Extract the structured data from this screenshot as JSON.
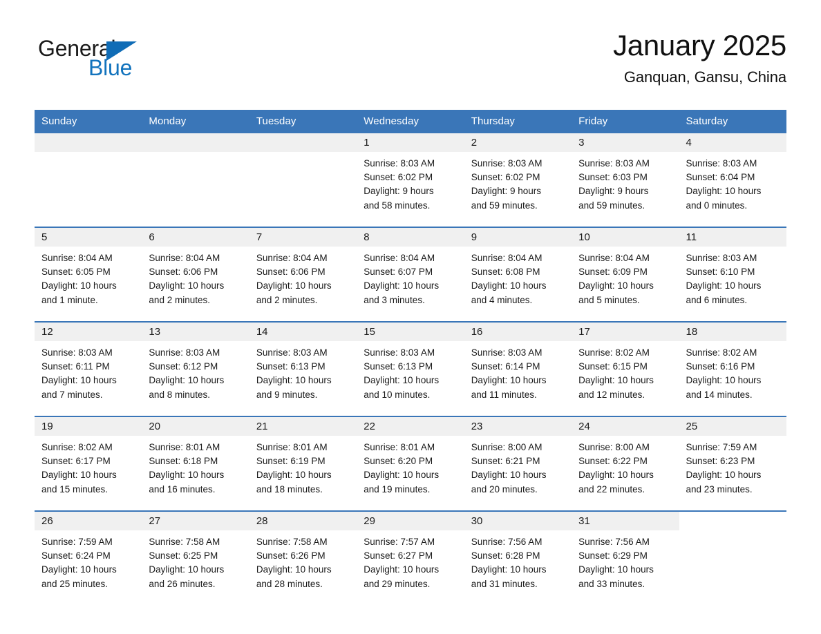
{
  "brand": {
    "name_part1": "General",
    "name_part2": "Blue",
    "triangle_color": "#0f6cb6",
    "blue_color": "#1273bd"
  },
  "header": {
    "month_title": "January 2025",
    "location": "Ganquan, Gansu, China"
  },
  "theme": {
    "header_bg": "#3a76b8",
    "header_text": "#ffffff",
    "daynum_band_bg": "#f0f0f0",
    "row_divider": "#3a76b8",
    "cell_bg": "#ffffff",
    "text": "#1a1a1a"
  },
  "weekday_headers": [
    "Sunday",
    "Monday",
    "Tuesday",
    "Wednesday",
    "Thursday",
    "Friday",
    "Saturday"
  ],
  "weeks": [
    [
      {
        "day": "",
        "sunrise": "",
        "sunset": "",
        "daylight_line1": "",
        "daylight_line2": "",
        "empty": true
      },
      {
        "day": "",
        "sunrise": "",
        "sunset": "",
        "daylight_line1": "",
        "daylight_line2": "",
        "empty": true
      },
      {
        "day": "",
        "sunrise": "",
        "sunset": "",
        "daylight_line1": "",
        "daylight_line2": "",
        "empty": true
      },
      {
        "day": "1",
        "sunrise": "Sunrise: 8:03 AM",
        "sunset": "Sunset: 6:02 PM",
        "daylight_line1": "Daylight: 9 hours",
        "daylight_line2": "and 58 minutes."
      },
      {
        "day": "2",
        "sunrise": "Sunrise: 8:03 AM",
        "sunset": "Sunset: 6:02 PM",
        "daylight_line1": "Daylight: 9 hours",
        "daylight_line2": "and 59 minutes."
      },
      {
        "day": "3",
        "sunrise": "Sunrise: 8:03 AM",
        "sunset": "Sunset: 6:03 PM",
        "daylight_line1": "Daylight: 9 hours",
        "daylight_line2": "and 59 minutes."
      },
      {
        "day": "4",
        "sunrise": "Sunrise: 8:03 AM",
        "sunset": "Sunset: 6:04 PM",
        "daylight_line1": "Daylight: 10 hours",
        "daylight_line2": "and 0 minutes."
      }
    ],
    [
      {
        "day": "5",
        "sunrise": "Sunrise: 8:04 AM",
        "sunset": "Sunset: 6:05 PM",
        "daylight_line1": "Daylight: 10 hours",
        "daylight_line2": "and 1 minute."
      },
      {
        "day": "6",
        "sunrise": "Sunrise: 8:04 AM",
        "sunset": "Sunset: 6:06 PM",
        "daylight_line1": "Daylight: 10 hours",
        "daylight_line2": "and 2 minutes."
      },
      {
        "day": "7",
        "sunrise": "Sunrise: 8:04 AM",
        "sunset": "Sunset: 6:06 PM",
        "daylight_line1": "Daylight: 10 hours",
        "daylight_line2": "and 2 minutes."
      },
      {
        "day": "8",
        "sunrise": "Sunrise: 8:04 AM",
        "sunset": "Sunset: 6:07 PM",
        "daylight_line1": "Daylight: 10 hours",
        "daylight_line2": "and 3 minutes."
      },
      {
        "day": "9",
        "sunrise": "Sunrise: 8:04 AM",
        "sunset": "Sunset: 6:08 PM",
        "daylight_line1": "Daylight: 10 hours",
        "daylight_line2": "and 4 minutes."
      },
      {
        "day": "10",
        "sunrise": "Sunrise: 8:04 AM",
        "sunset": "Sunset: 6:09 PM",
        "daylight_line1": "Daylight: 10 hours",
        "daylight_line2": "and 5 minutes."
      },
      {
        "day": "11",
        "sunrise": "Sunrise: 8:03 AM",
        "sunset": "Sunset: 6:10 PM",
        "daylight_line1": "Daylight: 10 hours",
        "daylight_line2": "and 6 minutes."
      }
    ],
    [
      {
        "day": "12",
        "sunrise": "Sunrise: 8:03 AM",
        "sunset": "Sunset: 6:11 PM",
        "daylight_line1": "Daylight: 10 hours",
        "daylight_line2": "and 7 minutes."
      },
      {
        "day": "13",
        "sunrise": "Sunrise: 8:03 AM",
        "sunset": "Sunset: 6:12 PM",
        "daylight_line1": "Daylight: 10 hours",
        "daylight_line2": "and 8 minutes."
      },
      {
        "day": "14",
        "sunrise": "Sunrise: 8:03 AM",
        "sunset": "Sunset: 6:13 PM",
        "daylight_line1": "Daylight: 10 hours",
        "daylight_line2": "and 9 minutes."
      },
      {
        "day": "15",
        "sunrise": "Sunrise: 8:03 AM",
        "sunset": "Sunset: 6:13 PM",
        "daylight_line1": "Daylight: 10 hours",
        "daylight_line2": "and 10 minutes."
      },
      {
        "day": "16",
        "sunrise": "Sunrise: 8:03 AM",
        "sunset": "Sunset: 6:14 PM",
        "daylight_line1": "Daylight: 10 hours",
        "daylight_line2": "and 11 minutes."
      },
      {
        "day": "17",
        "sunrise": "Sunrise: 8:02 AM",
        "sunset": "Sunset: 6:15 PM",
        "daylight_line1": "Daylight: 10 hours",
        "daylight_line2": "and 12 minutes."
      },
      {
        "day": "18",
        "sunrise": "Sunrise: 8:02 AM",
        "sunset": "Sunset: 6:16 PM",
        "daylight_line1": "Daylight: 10 hours",
        "daylight_line2": "and 14 minutes."
      }
    ],
    [
      {
        "day": "19",
        "sunrise": "Sunrise: 8:02 AM",
        "sunset": "Sunset: 6:17 PM",
        "daylight_line1": "Daylight: 10 hours",
        "daylight_line2": "and 15 minutes."
      },
      {
        "day": "20",
        "sunrise": "Sunrise: 8:01 AM",
        "sunset": "Sunset: 6:18 PM",
        "daylight_line1": "Daylight: 10 hours",
        "daylight_line2": "and 16 minutes."
      },
      {
        "day": "21",
        "sunrise": "Sunrise: 8:01 AM",
        "sunset": "Sunset: 6:19 PM",
        "daylight_line1": "Daylight: 10 hours",
        "daylight_line2": "and 18 minutes."
      },
      {
        "day": "22",
        "sunrise": "Sunrise: 8:01 AM",
        "sunset": "Sunset: 6:20 PM",
        "daylight_line1": "Daylight: 10 hours",
        "daylight_line2": "and 19 minutes."
      },
      {
        "day": "23",
        "sunrise": "Sunrise: 8:00 AM",
        "sunset": "Sunset: 6:21 PM",
        "daylight_line1": "Daylight: 10 hours",
        "daylight_line2": "and 20 minutes."
      },
      {
        "day": "24",
        "sunrise": "Sunrise: 8:00 AM",
        "sunset": "Sunset: 6:22 PM",
        "daylight_line1": "Daylight: 10 hours",
        "daylight_line2": "and 22 minutes."
      },
      {
        "day": "25",
        "sunrise": "Sunrise: 7:59 AM",
        "sunset": "Sunset: 6:23 PM",
        "daylight_line1": "Daylight: 10 hours",
        "daylight_line2": "and 23 minutes."
      }
    ],
    [
      {
        "day": "26",
        "sunrise": "Sunrise: 7:59 AM",
        "sunset": "Sunset: 6:24 PM",
        "daylight_line1": "Daylight: 10 hours",
        "daylight_line2": "and 25 minutes."
      },
      {
        "day": "27",
        "sunrise": "Sunrise: 7:58 AM",
        "sunset": "Sunset: 6:25 PM",
        "daylight_line1": "Daylight: 10 hours",
        "daylight_line2": "and 26 minutes."
      },
      {
        "day": "28",
        "sunrise": "Sunrise: 7:58 AM",
        "sunset": "Sunset: 6:26 PM",
        "daylight_line1": "Daylight: 10 hours",
        "daylight_line2": "and 28 minutes."
      },
      {
        "day": "29",
        "sunrise": "Sunrise: 7:57 AM",
        "sunset": "Sunset: 6:27 PM",
        "daylight_line1": "Daylight: 10 hours",
        "daylight_line2": "and 29 minutes."
      },
      {
        "day": "30",
        "sunrise": "Sunrise: 7:56 AM",
        "sunset": "Sunset: 6:28 PM",
        "daylight_line1": "Daylight: 10 hours",
        "daylight_line2": "and 31 minutes."
      },
      {
        "day": "31",
        "sunrise": "Sunrise: 7:56 AM",
        "sunset": "Sunset: 6:29 PM",
        "daylight_line1": "Daylight: 10 hours",
        "daylight_line2": "and 33 minutes."
      },
      {
        "day": "",
        "sunrise": "",
        "sunset": "",
        "daylight_line1": "",
        "daylight_line2": "",
        "empty": true,
        "blank_band": true
      }
    ]
  ]
}
